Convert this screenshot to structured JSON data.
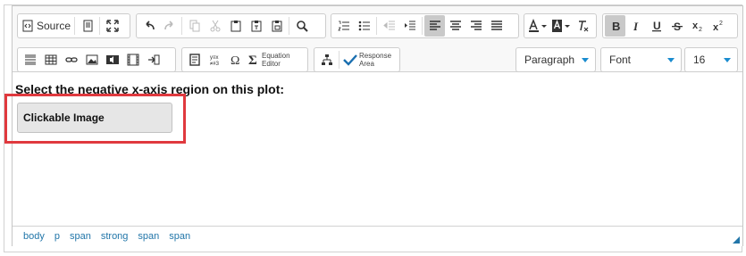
{
  "toolbar": {
    "source_label": "Source",
    "equation_editor_label": [
      "Equation",
      "Editor"
    ],
    "response_area_label": [
      "Response",
      "Area"
    ],
    "format_select": "Paragraph",
    "font_select": "Font",
    "size_select": "16",
    "accent_color": "#1a8ccf"
  },
  "content": {
    "heading": "Select the negative x-axis region on this plot:",
    "image_placeholder": "Clickable Image"
  },
  "statusbar": {
    "path": [
      "body",
      "p",
      "span",
      "strong",
      "span",
      "span"
    ]
  }
}
